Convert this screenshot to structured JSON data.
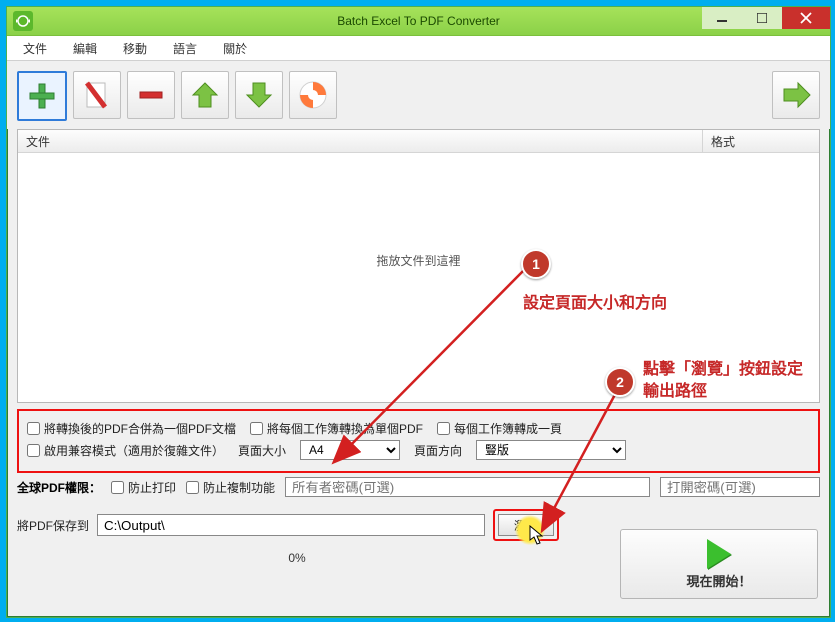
{
  "window": {
    "title": "Batch Excel To PDF Converter"
  },
  "menu": {
    "file": "文件",
    "edit": "編輯",
    "move": "移動",
    "lang": "語言",
    "about": "關於"
  },
  "list": {
    "col_file": "文件",
    "col_format": "格式",
    "drop_hint": "拖放文件到這裡"
  },
  "opts": {
    "merge": "將轉換後的PDF合併為一個PDF文檔",
    "each_sheet": "將每個工作簿轉換為單個PDF",
    "one_page": "每個工作簿轉成一頁",
    "compat": "啟用兼容模式（適用於復雜文件）",
    "page_size_label": "頁面大小",
    "page_size_value": "A4",
    "orient_label": "頁面方向",
    "orient_value": "豎版"
  },
  "perm": {
    "label": "全球PDF權限：",
    "no_print": "防止打印",
    "no_copy": "防止複制功能",
    "owner_pw_ph": "所有者密碼(可選)",
    "open_pw_ph": "打開密碼(可選)"
  },
  "save": {
    "label": "將PDF保存到",
    "path": "C:\\Output\\",
    "browse": "瀏覽"
  },
  "progress": {
    "text": "0%"
  },
  "start": {
    "label": "現在開始！"
  },
  "annot": {
    "n1": "1",
    "t1": "設定頁面大小和方向",
    "n2": "2",
    "t2": "點擊「瀏覽」按鈕設定輸出路徑"
  }
}
